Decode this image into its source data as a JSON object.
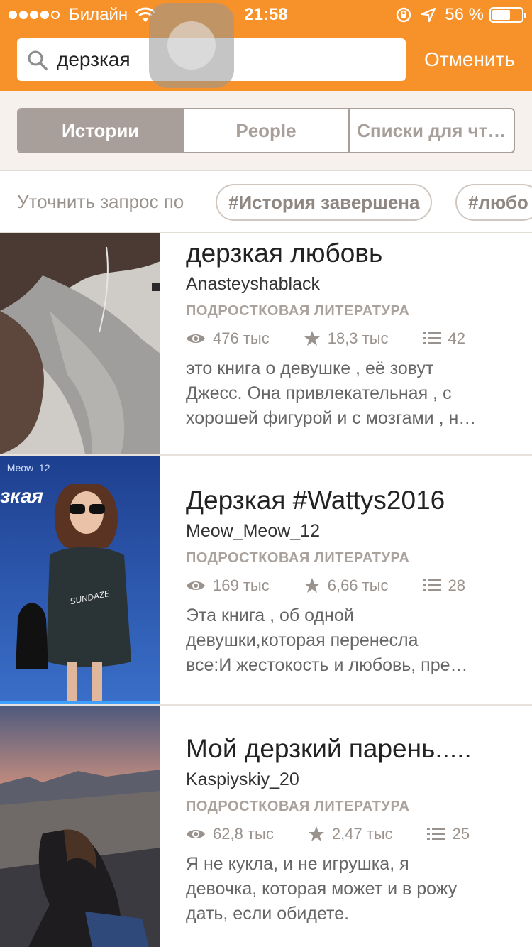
{
  "status_bar": {
    "carrier": "Билайн",
    "time": "21:58",
    "battery_percent": "56 %",
    "battery_level": 0.56
  },
  "search": {
    "query": "дерзкая",
    "cancel_label": "Отменить"
  },
  "tabs": [
    {
      "label": "Истории",
      "active": true
    },
    {
      "label": "People",
      "active": false
    },
    {
      "label": "Списки для чт…",
      "active": false
    }
  ],
  "refine": {
    "label": "Уточнить запрос по",
    "tags": [
      "#История завершена",
      "#любо"
    ]
  },
  "stories": [
    {
      "title": "дерзкая любовь",
      "author": "Anasteyshablack",
      "genre": "ПОДРОСТКОВАЯ ЛИТЕРАТУРА",
      "reads": "476 тыс",
      "votes": "18,3 тыс",
      "parts": "42",
      "description": [
        "это книга о девушке , её зовут",
        "Джесс. Она привлекательная , с",
        "хорошей фигурой и с мозгами , н…"
      ]
    },
    {
      "title": "Дерзкая #Wattys2016",
      "author": "Meow_Meow_12",
      "genre": "ПОДРОСТКОВАЯ ЛИТЕРАТУРА",
      "reads": "169 тыс",
      "votes": "6,66 тыс",
      "parts": "28",
      "cover_text": [
        "_Meow_12",
        "зкая"
      ],
      "shirt_text": "SUNDAZE",
      "description": [
        "Эта книга , об одной",
        "девушки,которая перенесла",
        "все:И жестокость и любовь, пре…"
      ]
    },
    {
      "title": "Мой дерзкий парень.....",
      "author": "Kaspiyskiy_20",
      "genre": "ПОДРОСТКОВАЯ ЛИТЕРАТУРА",
      "reads": "62,8 тыс",
      "votes": "2,47 тыс",
      "parts": "25",
      "description": [
        "Я не кукла, и не игрушка, я",
        "девочка, которая может и в рожу",
        "дать, если обидете."
      ]
    }
  ],
  "colors": {
    "header": "#f7922a",
    "segment": "#a89f9a",
    "background": "#f6f1ec"
  },
  "icons": [
    "wifi-icon",
    "lock-rotation-icon",
    "location-arrow-icon",
    "battery-icon",
    "search-icon",
    "eye-icon",
    "star-icon",
    "list-icon"
  ]
}
